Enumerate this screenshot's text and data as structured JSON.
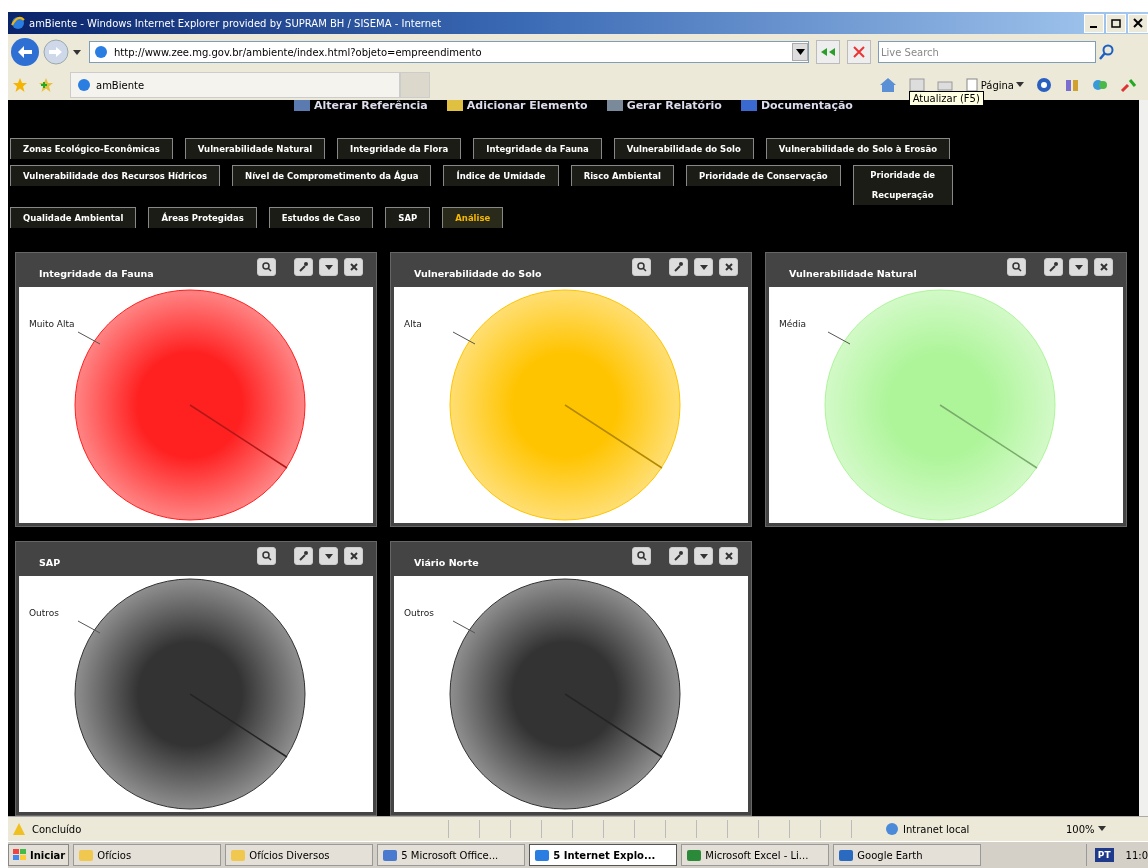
{
  "window": {
    "title": "amBiente - Windows Internet Explorer provided by SUPRAM BH / SISEMA - Internet"
  },
  "address_bar": {
    "url": "http://www.zee.mg.gov.br/ambiente/index.html?objeto=empreendimento"
  },
  "search": {
    "placeholder": "Live Search"
  },
  "browser_tab": {
    "title": "amBiente"
  },
  "command_bar": {
    "page_menu": "Página",
    "tooltip": "Atualizar (F5)"
  },
  "app_toolbar": [
    "Alterar Referência",
    "Adicionar Elemento",
    "Gerar Relatório",
    "Documentação"
  ],
  "tab_rows": [
    [
      {
        "label": "Zonas Ecológico-Econômicas",
        "selected": false
      },
      {
        "label": "Vulnerabilidade Natural",
        "selected": false
      },
      {
        "label": "Integridade da Flora",
        "selected": false
      },
      {
        "label": "Integridade da Fauna",
        "selected": false
      },
      {
        "label": "Vulnerabilidade do Solo",
        "selected": false
      },
      {
        "label": "Vulnerabilidade do Solo à Erosão",
        "selected": false
      }
    ],
    [
      {
        "label": "Vulnerabilidade dos Recursos Hídricos",
        "selected": false
      },
      {
        "label": "Nível de Comprometimento da Água",
        "selected": false
      },
      {
        "label": "Índice de Umidade",
        "selected": false
      },
      {
        "label": "Risco Ambiental",
        "selected": false
      },
      {
        "label": "Prioridade de Conservação",
        "selected": false
      },
      {
        "label": "Prioridade de Recuperação",
        "selected": false
      }
    ],
    [
      {
        "label": "Qualidade Ambiental",
        "selected": false
      },
      {
        "label": "Áreas Protegidas",
        "selected": false
      },
      {
        "label": "Estudos de Caso",
        "selected": false
      },
      {
        "label": "SAP",
        "selected": false
      },
      {
        "label": "Análise",
        "selected": true
      }
    ]
  ],
  "panels": [
    {
      "title": "Integridade da Fauna",
      "slice_label": "Muito Alta",
      "color": "#ff2020"
    },
    {
      "title": "Vulnerabilidade do Solo",
      "slice_label": "Alta",
      "color": "#ffc400"
    },
    {
      "title": "Vulnerabilidade Natural",
      "slice_label": "Média",
      "color": "#aef59a"
    },
    {
      "title": "SAP",
      "slice_label": "Outros",
      "color": "#333333"
    },
    {
      "title": "Viário Norte",
      "slice_label": "Outros",
      "color": "#333333"
    }
  ],
  "status_bar": {
    "status": "Concluído",
    "zone": "Intranet local",
    "zoom": "100%"
  },
  "taskbar": {
    "start": "Iniciar",
    "items": [
      {
        "label": "Ofícios",
        "selected": false
      },
      {
        "label": "Ofícios Diversos",
        "selected": false
      },
      {
        "label": "5 Microsoft Office...",
        "selected": false
      },
      {
        "label": "5 Internet Explo...",
        "selected": true
      },
      {
        "label": "Microsoft Excel - Li...",
        "selected": false
      },
      {
        "label": "Google Earth",
        "selected": false
      }
    ],
    "language": "PT",
    "clock": "11:0"
  }
}
